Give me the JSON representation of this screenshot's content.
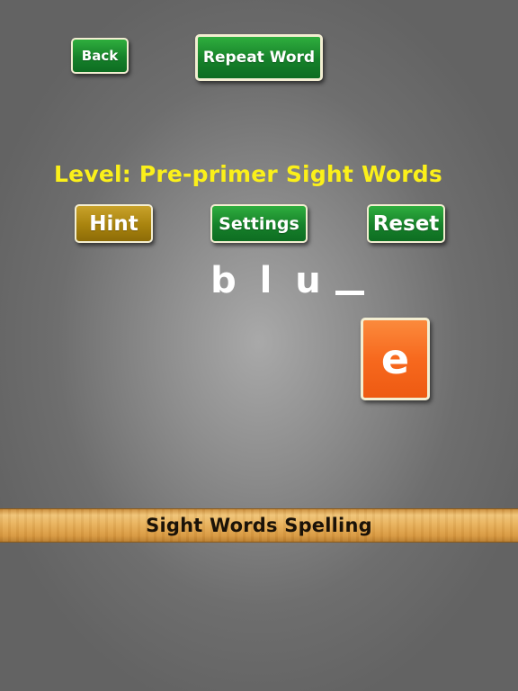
{
  "toolbar": {
    "back_label": "Back",
    "repeat_label": "Repeat Word"
  },
  "level": {
    "text": "Level: Pre-primer Sight Words"
  },
  "controls": {
    "hint_label": "Hint",
    "settings_label": "Settings",
    "reset_label": "Reset"
  },
  "word": {
    "letters": [
      "b",
      "l",
      "u",
      "_"
    ],
    "letter_1": "b",
    "letter_2": "l",
    "letter_3": "u"
  },
  "tile": {
    "letter": "e"
  },
  "footer": {
    "title": "Sight Words Spelling"
  },
  "colors": {
    "green_button": "#16812a",
    "gold_button": "#a8830e",
    "tile_orange": "#f7691e",
    "level_text": "#fbf01a"
  }
}
